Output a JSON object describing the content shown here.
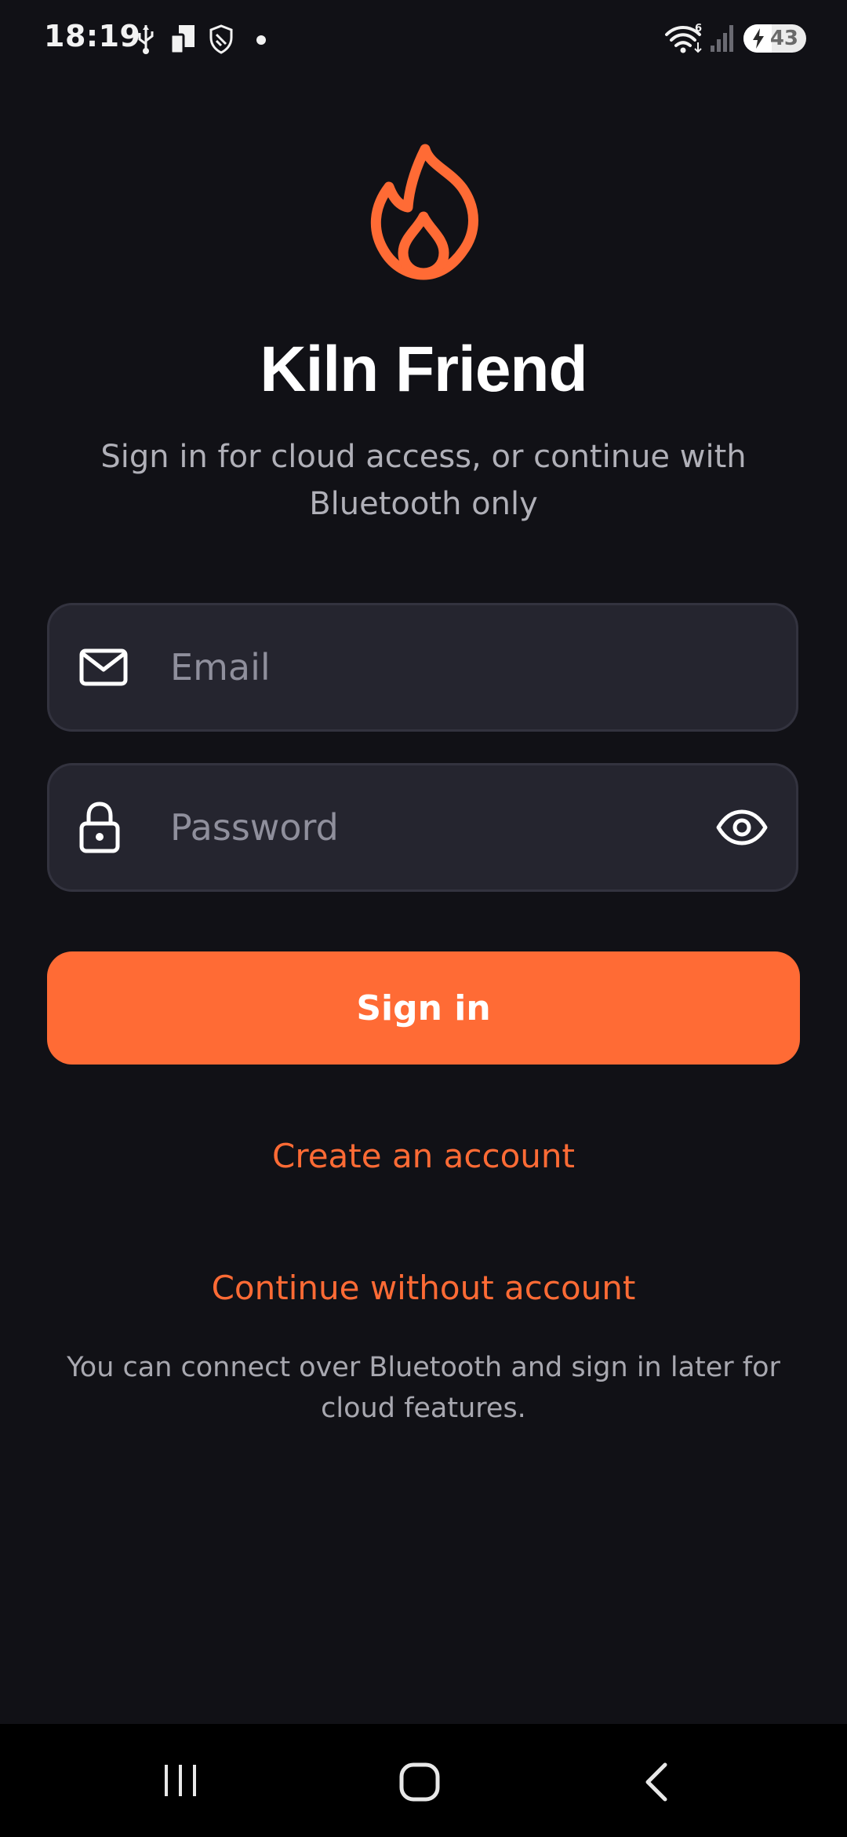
{
  "status_bar": {
    "time": "18:19",
    "icons": [
      "usb-icon",
      "sim-card-icon",
      "shield-icon",
      "notification-dot-icon",
      "wifi-icon",
      "signal-icon"
    ],
    "battery_level": "43"
  },
  "logo": {
    "icon": "flame-icon",
    "color": "#ff6b35"
  },
  "app": {
    "title": "Kiln Friend",
    "subtitle": "Sign in for cloud access, or continue with Bluetooth only"
  },
  "form": {
    "email": {
      "icon": "mail-icon",
      "placeholder": "Email",
      "value": ""
    },
    "password": {
      "icon": "lock-icon",
      "placeholder": "Password",
      "value": "",
      "toggle_icon": "eye-icon"
    },
    "sign_in_label": "Sign in"
  },
  "links": {
    "create_account": "Create an account",
    "continue_without_account": "Continue without account"
  },
  "hint": "You can connect over Bluetooth and sign in later for cloud features.",
  "nav_bar": {
    "recents_icon": "recents-icon",
    "home_icon": "home-icon",
    "back_icon": "back-icon"
  },
  "colors": {
    "background": "#111116",
    "accent": "#ff6b35",
    "field_background": "#25252f"
  }
}
